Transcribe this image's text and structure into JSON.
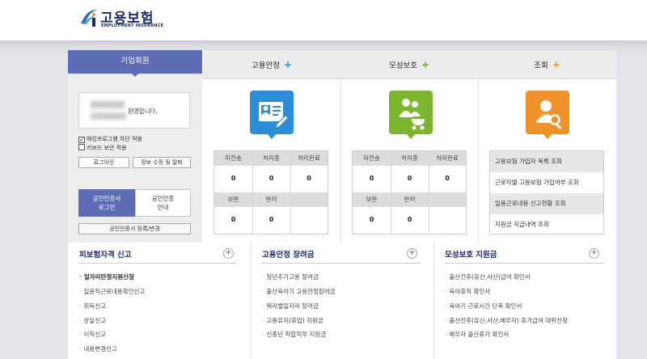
{
  "logo": {
    "title": "고용보험",
    "subtitle": "EMPLOYMENT INSURANCE"
  },
  "member": {
    "tab_label": "기업회원",
    "welcome_suffix": "환영합니다.",
    "checkbox_1": {
      "label": "해킹프로그램 차단 적용",
      "checked": true
    },
    "checkbox_2": {
      "label": "키보드 보안 적용",
      "checked": false
    },
    "logout_label": "로그아웃",
    "edit_info_label": "정보 수정 및 탈퇴",
    "cert_login_line1": "공인인증서",
    "cert_login_line2": "로그인",
    "cert_guide_line1": "공인인증",
    "cert_guide_line2": "안내",
    "cert_register_label": "공인인증서 등록/변경"
  },
  "tabs": [
    {
      "label": "고용안정",
      "plus": "+",
      "plus_color": "#2a8fd6"
    },
    {
      "label": "모성보호",
      "plus": "+",
      "plus_color": "#6aae2e"
    },
    {
      "label": "조회",
      "plus": "+",
      "plus_color": "#f0922a"
    }
  ],
  "icons": [
    {
      "name": "id-card-icon",
      "color": "#2a8fd6"
    },
    {
      "name": "family-stroller-icon",
      "color": "#7cb52e"
    },
    {
      "name": "user-search-icon",
      "color": "#f0922a"
    }
  ],
  "employment_stats": {
    "headers_top": [
      "미전송",
      "처리중",
      "처리완료"
    ],
    "values_top": [
      "0",
      "0",
      "0"
    ],
    "headers_bottom": [
      "보완",
      "반려",
      ""
    ],
    "values_bottom": [
      "0",
      "0",
      ""
    ]
  },
  "maternity_stats": {
    "headers_top": [
      "미전송",
      "처리중",
      "처리완료"
    ],
    "values_top": [
      "0",
      "0",
      "0"
    ],
    "headers_bottom": [
      "보완",
      "반려",
      ""
    ],
    "values_bottom": [
      "0",
      "0",
      ""
    ]
  },
  "inquiry_items": [
    "고용보험 가입자 목록 조회",
    "근로자별 고용보험 가입여부 조회",
    "일용근로내용 신고현황 조회",
    "지원금 지급내역 조회"
  ],
  "bottom_sections": [
    {
      "title": "피보험자격 신고",
      "items": [
        "일자리안정지원신청",
        "일용직근로내용확인신고",
        "취득신고",
        "상실신고",
        "이직신고",
        "내용변경신고"
      ],
      "bold_first": true
    },
    {
      "title": "고용안정 장려금",
      "items": [
        "청년추가고용 장려금",
        "출산육아기 고용안정장려금",
        "워라밸일자리 장려금",
        "고용유지(휴업) 지원금",
        "신중년 적합직무 지원금"
      ],
      "bold_first": false
    },
    {
      "title": "모성보호 지원금",
      "items": [
        "출산전후(유산,사산)급여 확인서",
        "육아휴직 확인서",
        "육아기 근로시간 단축 확인서",
        "출산전후(유산,사산,배우자) 휴가급여 대위신청",
        "배우자 출산휴가 확인서"
      ],
      "bold_first": false
    }
  ],
  "bottom_plus_label": "+"
}
